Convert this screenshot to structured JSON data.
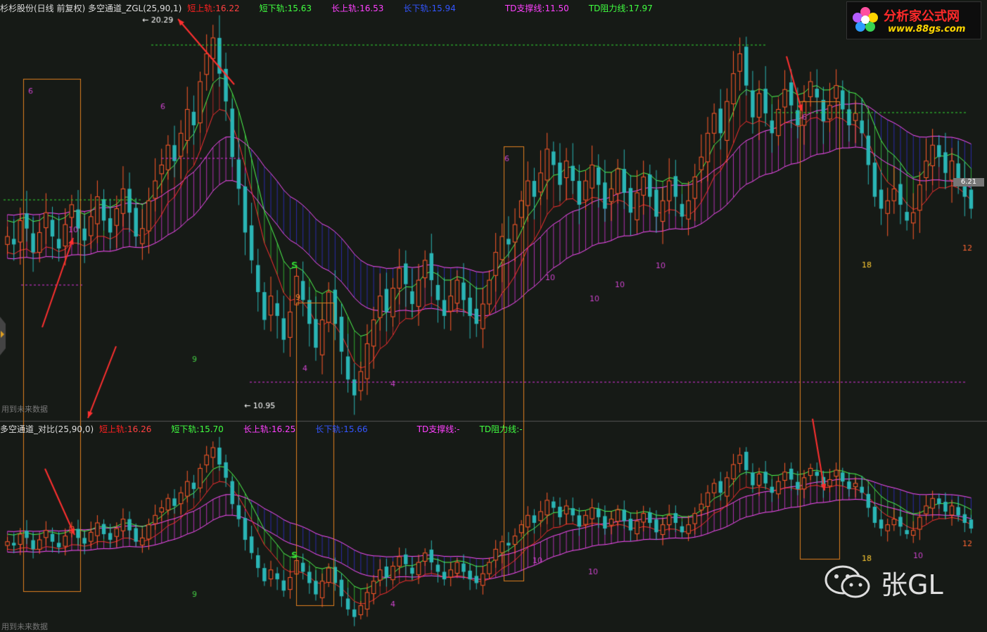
{
  "header_main": {
    "title": "杉杉股份(日线 前复权) 多空通道_ZGL(25,90,1)",
    "items": [
      {
        "label": "短上轨",
        "value": "16.22",
        "label_color": "#ff2020",
        "value_color": "#ff4040"
      },
      {
        "label": "短下轨",
        "value": "15.63",
        "label_color": "#40ff40",
        "value_color": "#40ff40"
      },
      {
        "label": "长上轨",
        "value": "16.53",
        "label_color": "#ff40ff",
        "value_color": "#ff40ff"
      },
      {
        "label": "长下轨",
        "value": "15.94",
        "label_color": "#3355ff",
        "value_color": "#3355ff"
      },
      {
        "label": "TD支撑线",
        "value": "11.50",
        "label_color": "#ff40ff",
        "value_color": "#ff40ff"
      },
      {
        "label": "TD阻力线",
        "value": "17.97",
        "label_color": "#40ff40",
        "value_color": "#40ff40"
      }
    ]
  },
  "header_sub": {
    "title": "多空通道_对比(25,90,0)",
    "items": [
      {
        "label": "短上轨",
        "value": "16.26",
        "label_color": "#ff2020",
        "value_color": "#ff4040"
      },
      {
        "label": "短下轨",
        "value": "15.70",
        "label_color": "#40ff40",
        "value_color": "#40ff40"
      },
      {
        "label": "长上轨",
        "value": "16.25",
        "label_color": "#ff40ff",
        "value_color": "#ff40ff"
      },
      {
        "label": "长下轨",
        "value": "15.66",
        "label_color": "#3355ff",
        "value_color": "#3355ff"
      },
      {
        "label": "TD支撑线",
        "value": "-",
        "label_color": "#ff40ff",
        "value_color": "#ff40ff"
      },
      {
        "label": "TD阻力线",
        "value": "-",
        "label_color": "#40ff40",
        "value_color": "#40ff40"
      }
    ]
  },
  "warn_text": "用到未来数据",
  "logo": {
    "cn": "分析家公式网",
    "url": "www.88gs.com"
  },
  "watermark": "张GL",
  "last_price_tag": "6.21",
  "chart_data": {
    "type": "candlestick",
    "panels": 2,
    "high_label": "20.29",
    "low_label": "10.95",
    "close": [
      15.0,
      14.8,
      15.4,
      15.2,
      14.6,
      15.1,
      15.6,
      15.0,
      14.7,
      15.3,
      15.8,
      15.2,
      14.9,
      15.5,
      16.0,
      15.4,
      15.1,
      15.7,
      16.2,
      15.6,
      15.0,
      15.2,
      15.9,
      16.4,
      16.8,
      17.3,
      16.9,
      17.6,
      18.2,
      17.8,
      18.9,
      19.6,
      20.0,
      19.1,
      18.4,
      17.0,
      16.2,
      15.1,
      14.4,
      13.6,
      12.9,
      13.5,
      13.0,
      12.4,
      13.1,
      14.0,
      13.4,
      12.8,
      12.2,
      12.9,
      13.6,
      12.8,
      12.1,
      11.4,
      11.0,
      11.6,
      12.3,
      12.9,
      13.5,
      13.1,
      13.7,
      14.2,
      13.8,
      13.3,
      13.9,
      14.4,
      13.9,
      13.4,
      13.0,
      13.5,
      13.9,
      13.4,
      13.0,
      12.8,
      13.3,
      13.9,
      14.6,
      15.0,
      14.8,
      15.3,
      15.9,
      16.4,
      16.0,
      16.6,
      17.2,
      16.8,
      16.3,
      16.9,
      16.4,
      15.8,
      16.4,
      16.8,
      16.3,
      15.7,
      16.2,
      16.7,
      16.1,
      15.6,
      16.1,
      16.5,
      16.0,
      15.5,
      15.9,
      16.4,
      16.0,
      15.5,
      15.9,
      16.5,
      17.0,
      17.6,
      18.1,
      17.6,
      18.4,
      19.1,
      19.6,
      18.8,
      18.0,
      18.6,
      18.1,
      17.6,
      18.2,
      18.7,
      18.3,
      17.8,
      18.4,
      18.9,
      18.5,
      17.9,
      18.3,
      18.8,
      18.2,
      17.8,
      18.1,
      17.6,
      16.8,
      16.0,
      15.7,
      15.9,
      16.2,
      15.8,
      15.4,
      15.6,
      16.3,
      16.9,
      17.3,
      17.0,
      16.6,
      16.9,
      16.4,
      16.0,
      15.7
    ],
    "panel_ranges": [
      [
        10.5,
        20.6
      ],
      [
        10.5,
        20.6
      ]
    ],
    "annotations": [
      "S",
      "6",
      "10",
      "4",
      "9",
      "18",
      "12"
    ]
  }
}
